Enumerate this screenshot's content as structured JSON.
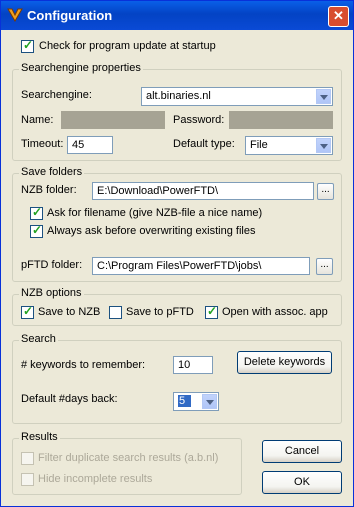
{
  "window": {
    "title": "Configuration",
    "close_glyph": "✕",
    "app_icon": "app-icon"
  },
  "update_check": {
    "label": "Check for program update at startup",
    "checked": true
  },
  "searchengine_group": {
    "title": "Searchengine properties",
    "searchengine_label": "Searchengine:",
    "searchengine_value": "alt.binaries.nl",
    "name_label": "Name:",
    "name_value": "",
    "password_label": "Password:",
    "password_value": "",
    "timeout_label": "Timeout:",
    "timeout_value": "45",
    "default_type_label": "Default type:",
    "default_type_value": "File"
  },
  "save_folders_group": {
    "title": "Save folders",
    "nzb_folder_label": "NZB folder:",
    "nzb_folder_value": "E:\\Download\\PowerFTD\\",
    "browse_label": "...",
    "ask_filename_label": "Ask for filename (give NZB-file a nice name)",
    "ask_filename_checked": true,
    "ask_overwrite_label": "Always ask before overwriting existing files",
    "ask_overwrite_checked": true,
    "pftd_folder_label": "pFTD folder:",
    "pftd_folder_value": "C:\\Program Files\\PowerFTD\\jobs\\"
  },
  "nzb_options_group": {
    "title": "NZB options",
    "save_nzb_label": "Save to NZB",
    "save_nzb_checked": true,
    "save_pftd_label": "Save to pFTD",
    "save_pftd_checked": false,
    "open_assoc_label": "Open with assoc. app",
    "open_assoc_checked": true
  },
  "search_group": {
    "title": "Search",
    "keywords_label": "# keywords to remember:",
    "keywords_value": "10",
    "delete_keywords_label": "Delete keywords",
    "days_back_label": "Default #days back:",
    "days_back_value": "5"
  },
  "results_group": {
    "title": "Results",
    "filter_dup_label": "Filter duplicate search results (a.b.nl)",
    "hide_incomplete_label": "Hide incomplete results"
  },
  "buttons": {
    "cancel": "Cancel",
    "ok": "OK"
  }
}
